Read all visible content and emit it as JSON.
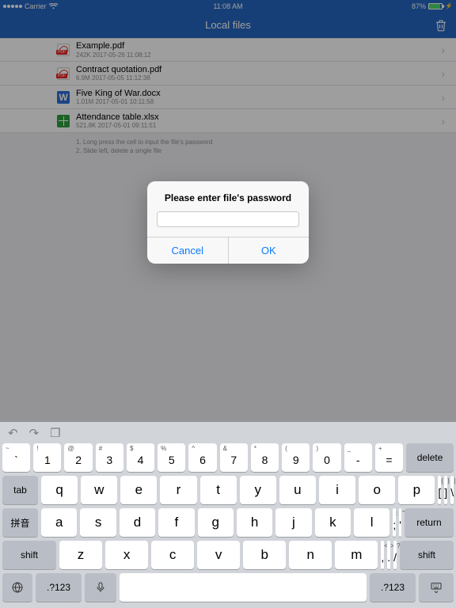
{
  "status": {
    "carrier": "Carrier",
    "time": "11:08 AM",
    "battery_pct": "87%"
  },
  "nav": {
    "title": "Local files"
  },
  "files": [
    {
      "name": "Example.pdf",
      "meta": "242K  2017-05-26 11:08:12",
      "type": "pdf"
    },
    {
      "name": "Contract quotation.pdf",
      "meta": "6.9M  2017-05-05 11:12:38",
      "type": "pdf"
    },
    {
      "name": "Five King of War.docx",
      "meta": "1.01M  2017-05-01 10:11:58",
      "type": "docx"
    },
    {
      "name": "Attendance table.xlsx",
      "meta": "521.8K  2017-05-01 09:11:51",
      "type": "xlsx"
    }
  ],
  "hints": {
    "l1": "1. Long press the cell to input the file's password",
    "l2": "2. Slide left, delete a single file"
  },
  "alert": {
    "title": "Please enter file's password",
    "cancel": "Cancel",
    "ok": "OK",
    "value": ""
  },
  "keyboard": {
    "row1": [
      {
        "sub": "~",
        "main": "`"
      },
      {
        "sub": "!",
        "main": "1"
      },
      {
        "sub": "@",
        "main": "2"
      },
      {
        "sub": "#",
        "main": "3"
      },
      {
        "sub": "$",
        "main": "4"
      },
      {
        "sub": "%",
        "main": "5"
      },
      {
        "sub": "^",
        "main": "6"
      },
      {
        "sub": "&",
        "main": "7"
      },
      {
        "sub": "*",
        "main": "8"
      },
      {
        "sub": "(",
        "main": "9"
      },
      {
        "sub": ")",
        "main": "0"
      },
      {
        "sub": "_",
        "main": "-"
      },
      {
        "sub": "+",
        "main": "="
      }
    ],
    "delete": "delete",
    "tab": "tab",
    "row2": [
      "q",
      "w",
      "e",
      "r",
      "t",
      "y",
      "u",
      "i",
      "o",
      "p"
    ],
    "row2b": [
      {
        "sub": "{",
        "main": "["
      },
      {
        "sub": "}",
        "main": "]"
      },
      {
        "sub": "|",
        "main": "\\"
      }
    ],
    "pinyin": "拼音",
    "row3": [
      "a",
      "s",
      "d",
      "f",
      "g",
      "h",
      "j",
      "k",
      "l"
    ],
    "row3b": [
      {
        "sub": ":",
        "main": ";"
      },
      {
        "sub": "\"",
        "main": "'"
      }
    ],
    "return": "return",
    "shift": "shift",
    "row4": [
      "z",
      "x",
      "c",
      "v",
      "b",
      "n",
      "m"
    ],
    "row4b": [
      {
        "sub": "<",
        "main": ","
      },
      {
        "sub": ">",
        "main": "."
      },
      {
        "sub": "?",
        "main": "/"
      }
    ],
    "numkey": ".?123"
  }
}
